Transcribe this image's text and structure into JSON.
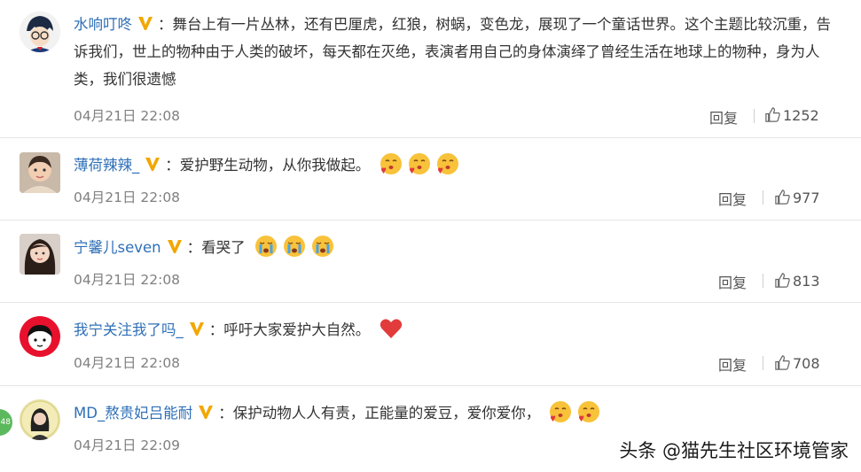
{
  "comments": [
    {
      "username": "水响叮咚",
      "text": "：舞台上有一片丛林，还有巴厘虎，红狼，树蜗，变色龙，展现了一个童话世界。这个主题比较沉重，告诉我们，世上的物种由于人类的破坏，每天都在灭绝，表演者用自己的身体演绎了曾经生活在地球上的物种，身为人类，我们很遗憾",
      "time": "04月21日 22:08",
      "reply": "回复",
      "likes": "1252"
    },
    {
      "username": "薄荷辣辣_",
      "text": "：爱护野生动物，从你我做起。",
      "time": "04月21日 22:08",
      "reply": "回复",
      "likes": "977"
    },
    {
      "username": "宁馨儿seven",
      "text": "：看哭了",
      "time": "04月21日 22:08",
      "reply": "回复",
      "likes": "813"
    },
    {
      "username": "我宁关注我了吗_",
      "text": "：呼吁大家爱护大自然。",
      "time": "04月21日 22:08",
      "reply": "回复",
      "likes": "708"
    },
    {
      "username": "MD_熬贵妃吕能耐",
      "text": "：保护动物人人有责，正能量的爱豆，爱你爱你，",
      "time": "04月21日 22:09",
      "reply": "",
      "likes": ""
    }
  ],
  "edge_badge": "48",
  "watermark": "头条 @猫先生社区环境管家",
  "icons": [
    "verified-v-badge-icon",
    "thumbs-up-icon",
    "kiss-emoji-icon",
    "crying-emoji-icon",
    "red-heart-icon"
  ],
  "colors": {
    "username": "#2e6fb7",
    "badge": "#f2a700",
    "time": "#808080"
  }
}
